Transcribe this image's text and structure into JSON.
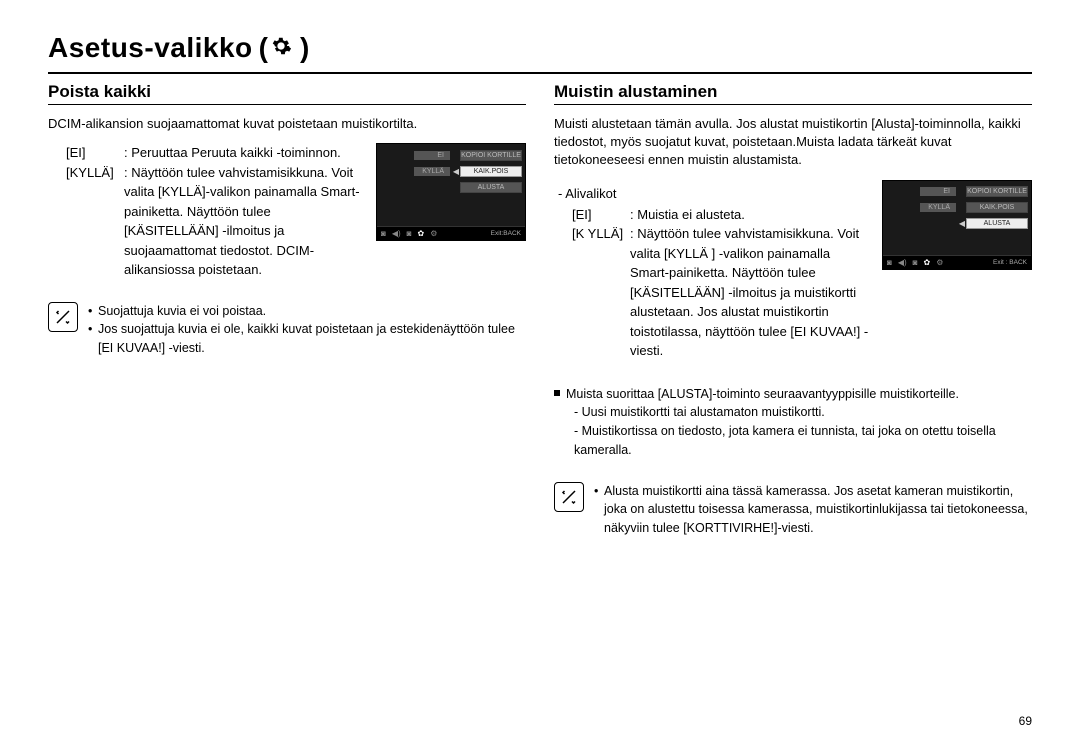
{
  "page_title": "Asetus-valikko",
  "title_icon": "settings-gear-icon",
  "page_number": "69",
  "left": {
    "heading": "Poista kaikki",
    "intro": "DCIM-alikansion suojaamattomat kuvat poistetaan muistikortilta.",
    "options": [
      {
        "label": "[EI]",
        "desc": "Peruuttaa Peruuta kaikki -toiminnon."
      },
      {
        "label": "[KYLLÄ]",
        "desc": "Näyttöön tulee vahvistamisikkuna. Voit valita [KYLLÄ]-valikon painamalla Smart-painiketta. Näyttöön tulee [KÄSITELLÄÄN] -ilmoitus ja suojaamattomat tiedostot. DCIM-alikansiossa poistetaan."
      }
    ],
    "screen": {
      "rows": [
        {
          "left": "EI",
          "arrow": "",
          "right": "KOPIOI KORTILLE",
          "right_dark": true
        },
        {
          "left": "KYLLÄ",
          "arrow": "◀",
          "right": "KAIK.POIS",
          "right_dark": false
        },
        {
          "left": "",
          "arrow": "",
          "right": "ALUSTA",
          "right_dark": true
        }
      ],
      "exit": "Exit:BACK"
    },
    "note": [
      "Suojattuja kuvia ei voi poistaa.",
      "Jos suojattuja kuvia ei ole, kaikki kuvat poistetaan ja estekidenäyttöön tulee [EI KUVAA!] -viesti."
    ]
  },
  "right": {
    "heading": "Muistin alustaminen",
    "intro": "Muisti alustetaan tämän avulla. Jos alustat muistikortin [Alusta]-toiminnolla, kaikki tiedostot, myös suojatut kuvat, poistetaan.Muista ladata tärkeät kuvat tietokoneeseesi ennen muistin alustamista.",
    "sub_label": "- Alivalikot",
    "options": [
      {
        "label": "[EI]",
        "desc": "Muistia ei alusteta."
      },
      {
        "label": "[K YLLÄ]",
        "desc": "Näyttöön tulee vahvistamisikkuna. Voit valita [KYLLÄ ] -valikon painamalla Smart-painiketta. Näyttöön tulee [KÄSITELLÄÄN] -ilmoitus ja muistikortti alustetaan. Jos alustat muistikortin toistotilassa, näyttöön tulee [EI KUVAA!] -viesti."
      }
    ],
    "screen": {
      "rows": [
        {
          "left": "EI",
          "arrow": "",
          "right": "KOPIOI KORTILLE",
          "right_dark": true
        },
        {
          "left": "KYLLÄ",
          "arrow": "",
          "right": "KAIK.POIS",
          "right_dark": true
        },
        {
          "left": "",
          "arrow": "◀",
          "right": "ALUSTA",
          "right_dark": false
        }
      ],
      "exit": "Exit : BACK"
    },
    "square_note": {
      "lead": "Muista suorittaa [ALUSTA]-toiminto seuraavantyyppisille muistikorteille.",
      "subs": [
        "- Uusi muistikortti tai alustamaton muistikortti.",
        "- Muistikortissa on tiedosto, jota kamera ei tunnista, tai joka on otettu toisella kameralla."
      ]
    },
    "note": [
      "Alusta muistikortti aina tässä kamerassa. Jos asetat kameran muistikortin, joka on alustettu toisessa kamerassa, muistikortinlukijassa tai tietokoneessa, näkyviin tulee [KORTTIVIRHE!]-viesti."
    ]
  }
}
